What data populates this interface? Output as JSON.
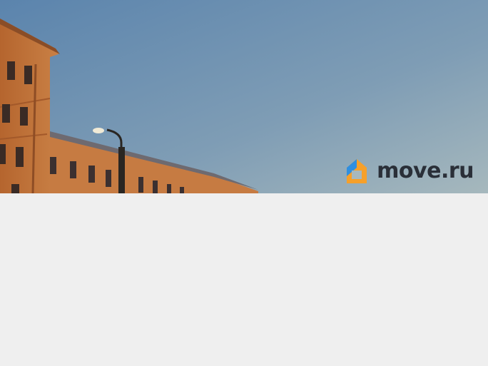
{
  "hero": {
    "logo": {
      "text": "move.ru",
      "icon": "house-icon",
      "colors": {
        "orange": "#f6a02a",
        "blue": "#2f8fe0",
        "text": "#2a2f38"
      }
    },
    "sky_colors": [
      "#5f86ad",
      "#9fb3bb"
    ],
    "building_color": "#b86a33"
  },
  "content": {
    "background": "#efefef"
  }
}
